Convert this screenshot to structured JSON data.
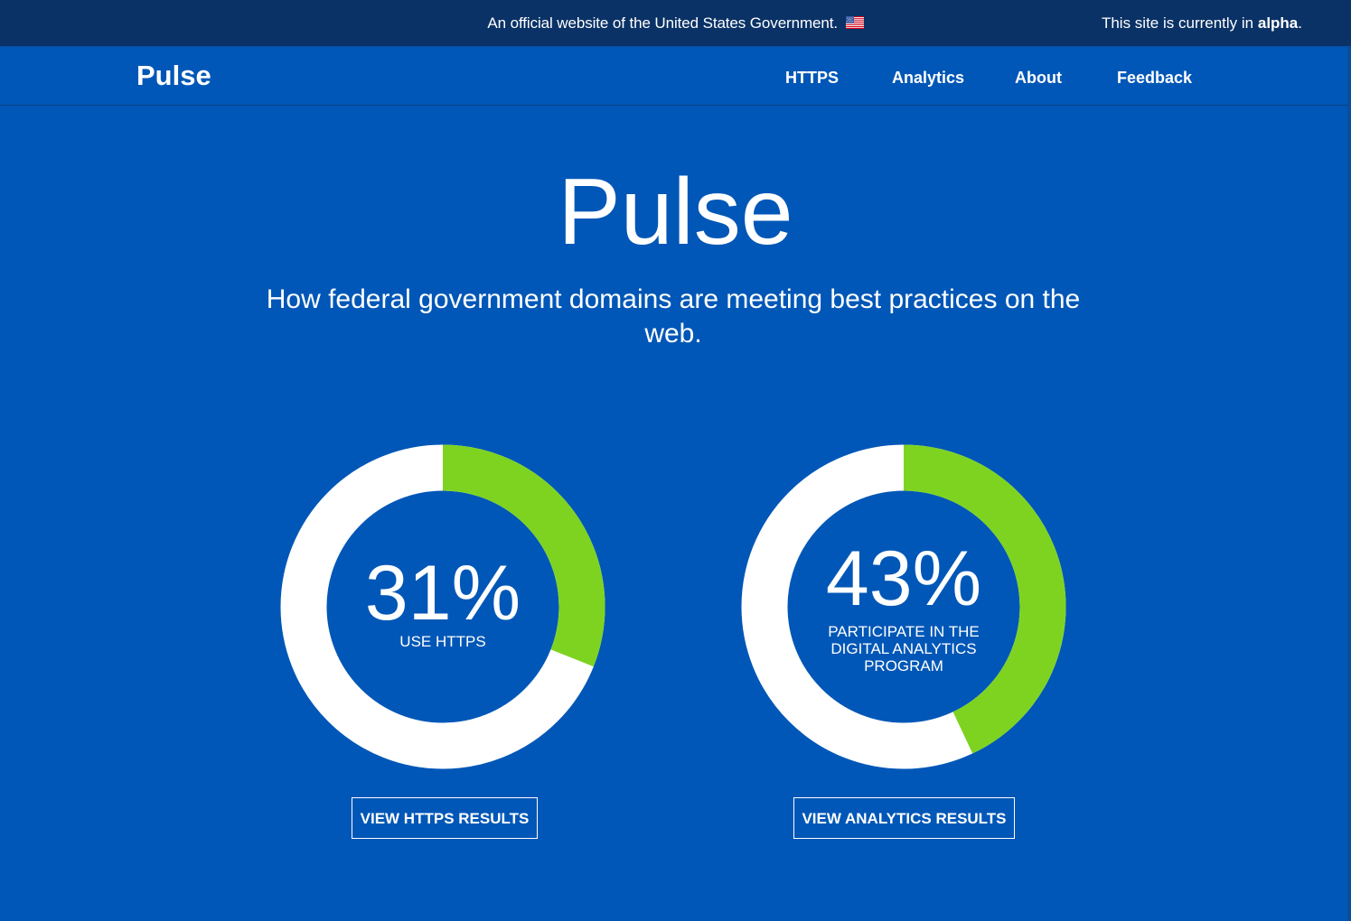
{
  "gov_banner": {
    "official_text": "An official website of the United States Government.",
    "flag_icon": "us-flag-icon",
    "alpha_prefix": "This site is currently in ",
    "alpha_word": "alpha",
    "alpha_suffix": "."
  },
  "nav": {
    "brand": "Pulse",
    "links": [
      {
        "label": "HTTPS"
      },
      {
        "label": "Analytics"
      },
      {
        "label": "About"
      },
      {
        "label": "Feedback"
      }
    ]
  },
  "hero": {
    "title": "Pulse",
    "subtitle": "How federal government domains are meeting best practices on the web."
  },
  "stats": [
    {
      "value": "31%",
      "percent": 31,
      "label": "USE HTTPS",
      "button": "VIEW HTTPS RESULTS"
    },
    {
      "value": "43%",
      "percent": 43,
      "label": "PARTICIPATE IN THE DIGITAL ANALYTICS PROGRAM",
      "button": "VIEW ANALYTICS RESULTS"
    }
  ],
  "colors": {
    "page_bg": "#0057b7",
    "banner_bg": "#0a3266",
    "donut_fill": "#7ed321",
    "donut_track": "#ffffff",
    "text": "#ffffff"
  }
}
